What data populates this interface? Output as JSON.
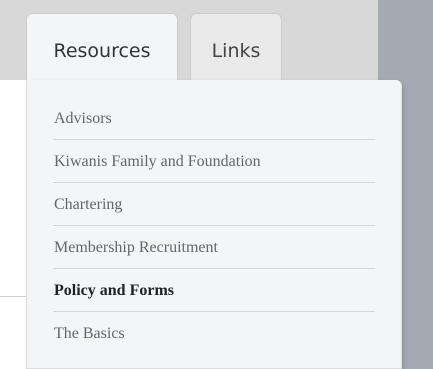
{
  "tabs": [
    {
      "label": "Resources",
      "active": true
    },
    {
      "label": "Links",
      "active": false
    }
  ],
  "dropdown": {
    "items": [
      {
        "label": "Advisors"
      },
      {
        "label": "Kiwanis Family and Foundation"
      },
      {
        "label": "Chartering"
      },
      {
        "label": "Membership Recruitment"
      },
      {
        "label": "Policy and Forms",
        "active": true
      },
      {
        "label": "The Basics"
      }
    ]
  },
  "colors": {
    "sidebar": "#a3aab4",
    "panel": "#f4f5f7",
    "tab_inactive": "#e9e9e9"
  }
}
